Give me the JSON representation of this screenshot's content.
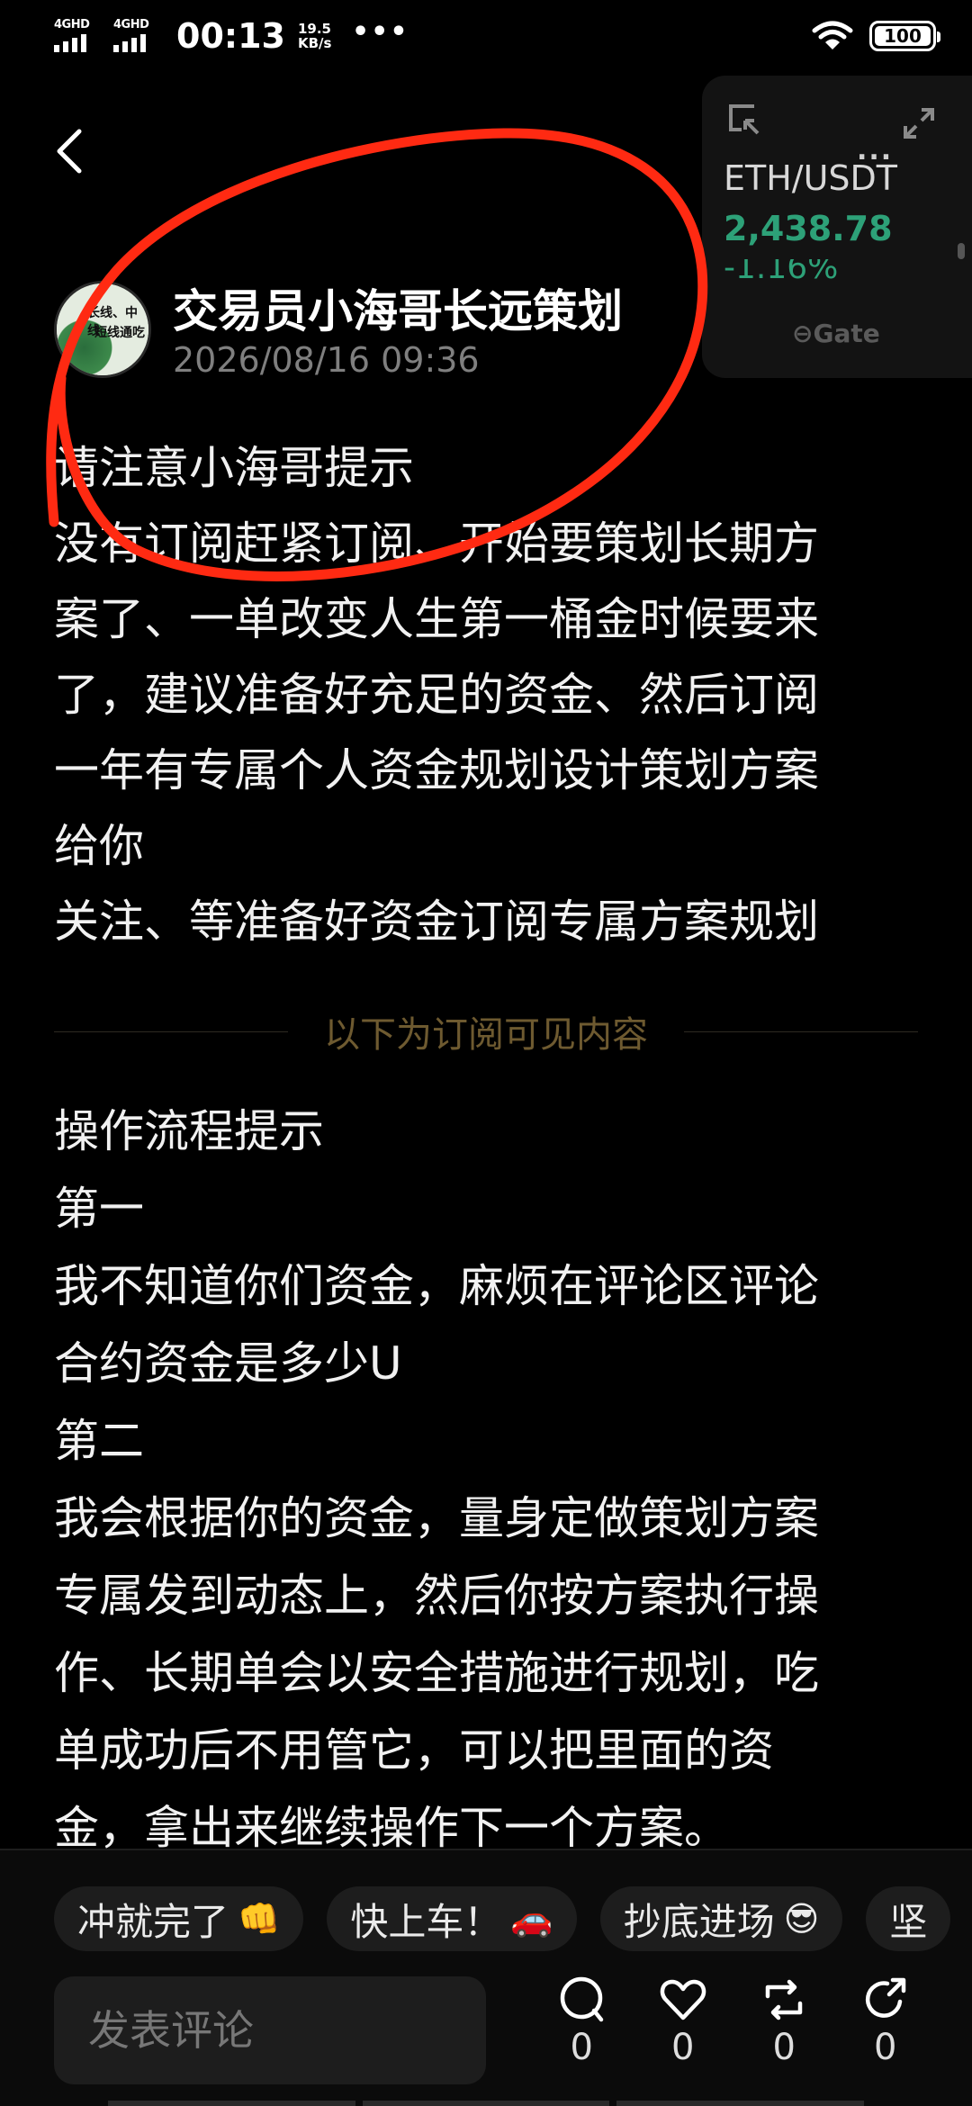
{
  "status_bar": {
    "net1": "4GHD",
    "net2": "4GHD",
    "time": "00:13",
    "speed_value": "19.5",
    "speed_unit": "KB/s",
    "dots": "•••",
    "battery": "100"
  },
  "ticker": {
    "more": "...",
    "pair": "ETH/USDT",
    "price": "2,438.78",
    "change": "-1.16%",
    "brand": "Gate",
    "up_color": "#2da178"
  },
  "author": {
    "avatar_text1": "长线、中线",
    "avatar_text2": "短线通吃",
    "name": "交易员小海哥长远策划",
    "time": "2026/08/16 09:36"
  },
  "post": {
    "lines": [
      "请注意小海哥提示",
      "没有订阅赶紧订阅、开始要策划长期方",
      "案了、一单改变人生第一桶金时候要来",
      "了，建议准备好充足的资金、然后订阅",
      "一年有专属个人资金规划设计策划方案",
      "给你",
      "关注、等准备好资金订阅专属方案规划"
    ],
    "divider_label": "以下为订阅可见内容",
    "subscribed_lines": [
      "操作流程提示",
      "第一",
      "我不知道你们资金，麻烦在评论区评论",
      "合约资金是多少U",
      "第二",
      "我会根据你的资金，量身定做策划方案",
      "专属发到动态上，然后你按方案执行操",
      "作、长期单会以安全措施进行规划，吃",
      "单成功后不用管它，可以把里面的资",
      "金，拿出来继续操作下一个方案。"
    ]
  },
  "quick_replies": [
    {
      "label": "冲就完了",
      "emoji": "👊"
    },
    {
      "label": "快上车！",
      "emoji": "🚗"
    },
    {
      "label": "抄底进场",
      "emoji": "😎"
    },
    {
      "label": "坚",
      "emoji": ""
    }
  ],
  "comment": {
    "placeholder": "发表评论"
  },
  "actions": {
    "comment_count": "0",
    "like_count": "0",
    "repost_count": "0",
    "share_count": "0"
  }
}
